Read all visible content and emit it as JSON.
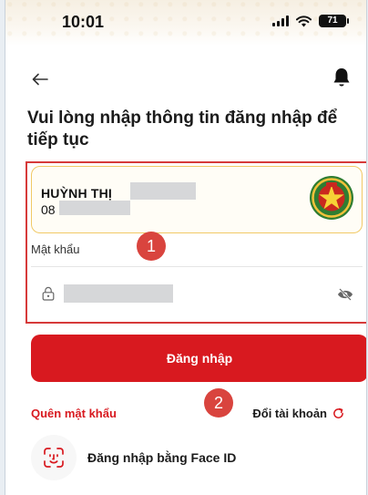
{
  "status_bar": {
    "time": "10:01",
    "battery": "71"
  },
  "page": {
    "title": "Vui lòng nhập thông tin đăng nhập để tiếp tục"
  },
  "account": {
    "name": "HUỲNH THỊ",
    "phone_prefix": "08"
  },
  "password": {
    "label": "Mật khẩu"
  },
  "annotations": {
    "step1": "1",
    "step2": "2",
    "highlight_color": "#d63a3a"
  },
  "actions": {
    "login": "Đăng nhập",
    "forgot_password": "Quên mật khẩu",
    "switch_account": "Đổi tài khoản",
    "face_id": "Đăng nhập bằng Face ID"
  },
  "icons": [
    "back-arrow-icon",
    "bell-icon",
    "police-logo",
    "lock-icon",
    "eye-off-icon",
    "refresh-icon",
    "face-id-icon",
    "signal-icon",
    "wifi-icon",
    "battery-icon"
  ],
  "colors": {
    "primary": "#d8191f",
    "card_border": "#f1c966"
  }
}
